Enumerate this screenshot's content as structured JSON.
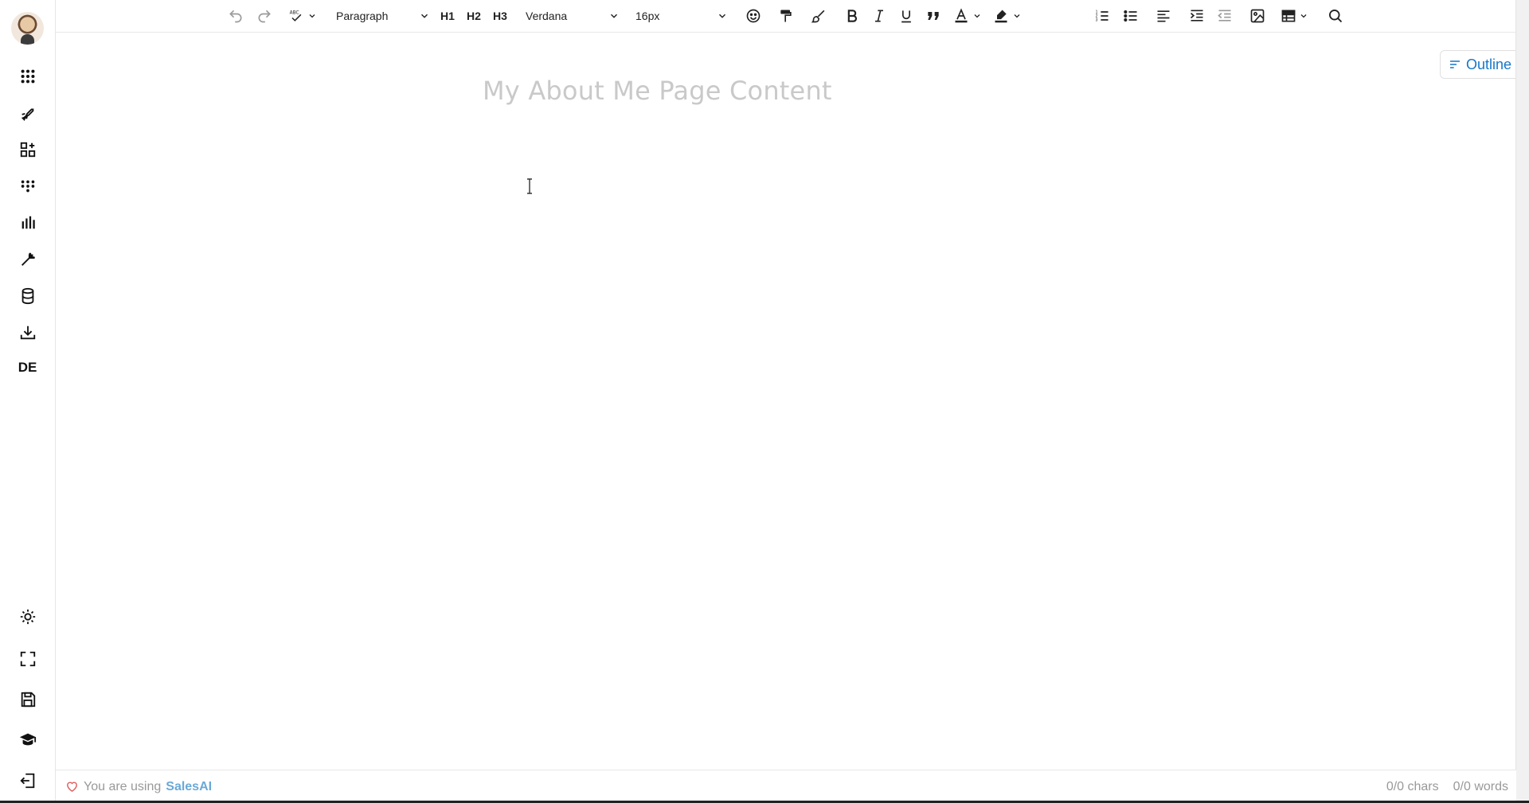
{
  "toolbar": {
    "block_type": "Paragraph",
    "headings": [
      "H1",
      "H2",
      "H3"
    ],
    "font_family": "Verdana",
    "font_size": "16px"
  },
  "editor": {
    "title_placeholder": "My About Me Page Content",
    "outline_label": "Outline"
  },
  "sidebar": {
    "lang_label": "DE",
    "icons": [
      "apps-grid-icon",
      "rocket-icon",
      "widgets-add-icon",
      "dial-grid-icon",
      "bar-chart-icon",
      "magic-wand-icon",
      "database-icon",
      "download-icon",
      "sun-icon",
      "fullscreen-icon",
      "save-icon",
      "graduation-cap-icon",
      "exit-icon"
    ]
  },
  "footer": {
    "prefix": "You are using",
    "brand": "SalesAI",
    "chars": "0/0 chars",
    "words": "0/0 words"
  },
  "colors": {
    "accent": "#1677c8",
    "brand_link": "#6aa9d8",
    "placeholder": "#c9c9c9",
    "heart": "#e05a5a"
  }
}
